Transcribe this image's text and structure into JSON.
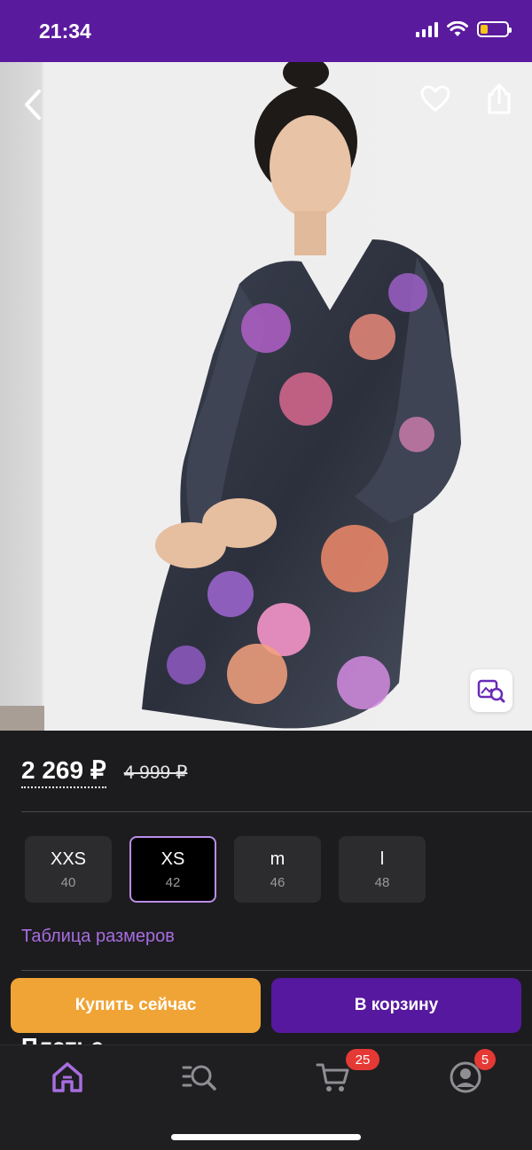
{
  "status_bar": {
    "time": "21:34",
    "icons": [
      "signal-icon",
      "wifi-icon",
      "battery-icon"
    ],
    "battery_level": 0.3
  },
  "product": {
    "image_alt": "",
    "actions": {
      "back": "chevron-left-icon",
      "favorite": "heart-icon",
      "share": "share-icon",
      "visual_search": "image-search-icon"
    },
    "price_current": "2 269 ₽",
    "price_old": "4 999 ₽",
    "sizes": [
      {
        "label": "XXS",
        "num": "40",
        "selected": false
      },
      {
        "label": "XS",
        "num": "42",
        "selected": true
      },
      {
        "label": "m",
        "num": "46",
        "selected": false
      },
      {
        "label": "l",
        "num": "48",
        "selected": false
      }
    ],
    "size_table_label": "Таблица размеров",
    "title_peek": "Платье"
  },
  "actions": {
    "buy_now": "Купить сейчас",
    "add_to_cart": "В корзину"
  },
  "tab_bar": {
    "items": [
      {
        "name": "home",
        "icon": "home-icon",
        "active": true
      },
      {
        "name": "catalog",
        "icon": "catalog-search-icon",
        "active": false
      },
      {
        "name": "cart",
        "icon": "cart-icon",
        "active": false,
        "badge": "25"
      },
      {
        "name": "profile",
        "icon": "profile-icon",
        "active": false,
        "badge": "5"
      }
    ]
  },
  "colors": {
    "brand_purple": "#5a1a9e",
    "buy_orange": "#f0a436",
    "link_purple": "#a86de0",
    "badge_red": "#e53935",
    "background": "#1c1c1e"
  }
}
